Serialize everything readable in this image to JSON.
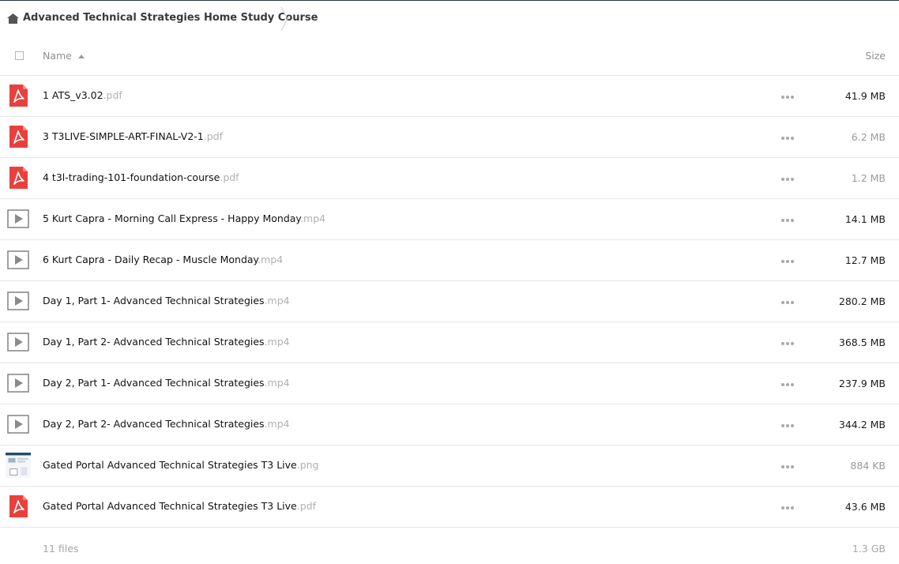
{
  "breadcrumb": {
    "folder": "Advanced Technical Strategies Home Study Course",
    "icon": "home-icon"
  },
  "header": {
    "name_label": "Name",
    "size_label": "Size",
    "sort": "ascending"
  },
  "files": [
    {
      "base": "1 ATS_v3.02",
      "ext": ".pdf",
      "size": "41.9 MB",
      "type": "pdf",
      "size_tone": "dark"
    },
    {
      "base": "3 T3LIVE-SIMPLE-ART-FINAL-V2-1",
      "ext": ".pdf",
      "size": "6.2 MB",
      "type": "pdf",
      "size_tone": "light"
    },
    {
      "base": "4 t3l-trading-101-foundation-course",
      "ext": ".pdf",
      "size": "1.2 MB",
      "type": "pdf",
      "size_tone": "light"
    },
    {
      "base": "5 Kurt Capra - Morning Call Express - Happy Monday",
      "ext": ".mp4",
      "size": "14.1 MB",
      "type": "video",
      "size_tone": "dark"
    },
    {
      "base": "6 Kurt Capra - Daily Recap - Muscle Monday",
      "ext": ".mp4",
      "size": "12.7 MB",
      "type": "video",
      "size_tone": "dark"
    },
    {
      "base": "Day 1, Part 1- Advanced Technical Strategies",
      "ext": ".mp4",
      "size": "280.2 MB",
      "type": "video",
      "size_tone": "dark"
    },
    {
      "base": "Day 1, Part 2- Advanced Technical Strategies",
      "ext": ".mp4",
      "size": "368.5 MB",
      "type": "video",
      "size_tone": "dark"
    },
    {
      "base": "Day 2, Part 1- Advanced Technical Strategies",
      "ext": ".mp4",
      "size": "237.9 MB",
      "type": "video",
      "size_tone": "dark"
    },
    {
      "base": "Day 2, Part 2- Advanced Technical Strategies",
      "ext": ".mp4",
      "size": "344.2 MB",
      "type": "video",
      "size_tone": "dark"
    },
    {
      "base": "Gated Portal Advanced Technical Strategies T3 Live",
      "ext": ".png",
      "size": "884 KB",
      "type": "image",
      "size_tone": "light"
    },
    {
      "base": "Gated Portal Advanced Technical Strategies T3 Live",
      "ext": ".pdf",
      "size": "43.6 MB",
      "type": "pdf",
      "size_tone": "dark"
    }
  ],
  "footer": {
    "count": "11 files",
    "total": "1.3 GB"
  },
  "colors": {
    "pdf_red": "#e8413d",
    "video_gray": "#8a8a8a",
    "divider": "#e6e6e6"
  }
}
